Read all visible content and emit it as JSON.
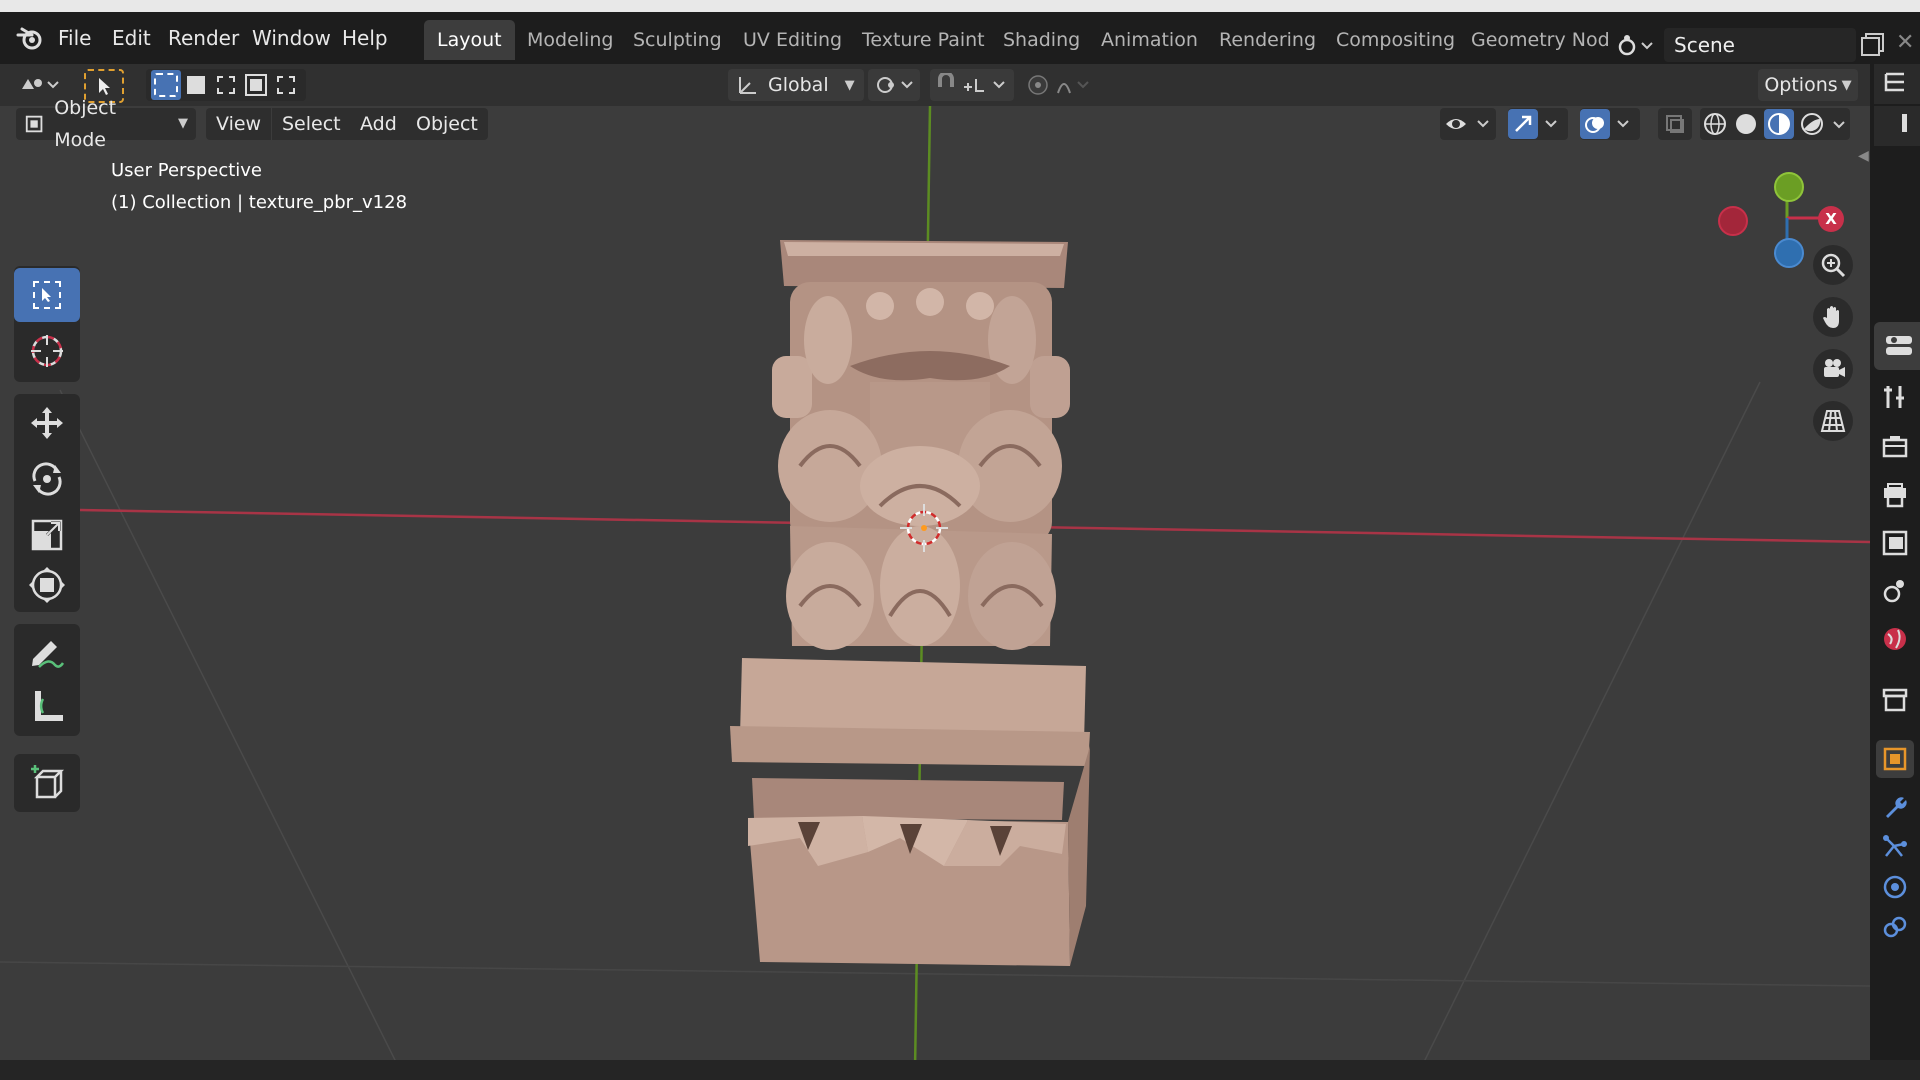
{
  "app": {
    "menu": [
      "File",
      "Edit",
      "Render",
      "Window",
      "Help"
    ],
    "workspaces": [
      "Layout",
      "Modeling",
      "Sculpting",
      "UV Editing",
      "Texture Paint",
      "Shading",
      "Animation",
      "Rendering",
      "Compositing",
      "Geometry Nod"
    ],
    "active_workspace": "Layout",
    "scene_name": "Scene"
  },
  "tool_header": {
    "transform_orientation": "Global",
    "options_label": "Options"
  },
  "viewport_header": {
    "mode": "Object Mode",
    "menus": [
      "View",
      "Select",
      "Add",
      "Object"
    ]
  },
  "viewport": {
    "view_name": "User Perspective",
    "collection_info": "(1) Collection | texture_pbr_v128",
    "gizmo": {
      "x_label": "X"
    }
  },
  "colors": {
    "accent": "#4772b3",
    "x_axis": "#c8304a",
    "y_axis": "#6b9e24",
    "z_axis": "#2f6fb0",
    "object": "#c4a18e"
  },
  "toolbar_tools": [
    "select-box",
    "cursor",
    "move",
    "rotate",
    "scale",
    "transform",
    "annotate",
    "measure",
    "add-cube"
  ],
  "properties_tabs": [
    "tool",
    "render",
    "output",
    "view-layer",
    "scene",
    "world",
    "collection",
    "object",
    "modifiers",
    "particles",
    "physics",
    "constraints"
  ]
}
